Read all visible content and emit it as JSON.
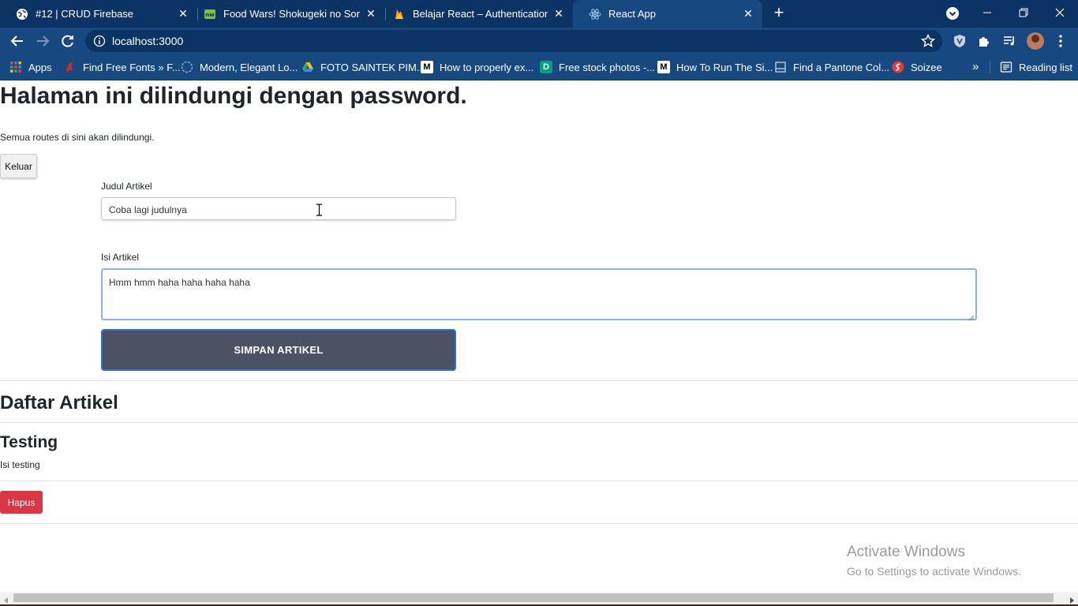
{
  "browser": {
    "tabs": [
      {
        "title": "#12 | CRUD Firebase",
        "favicon": "globe-icon",
        "active": false
      },
      {
        "title": "Food Wars! Shokugeki no Soma t",
        "favicon": "anime-site-icon",
        "active": false
      },
      {
        "title": "Belajar React – Authentication – I",
        "favicon": "firebase-icon",
        "active": false
      },
      {
        "title": "React App",
        "favicon": "react-icon",
        "active": true
      }
    ],
    "new_tab_label": "+",
    "url": "localhost:3000",
    "bookmarks": [
      {
        "label": "Apps",
        "icon": "apps-grid-icon"
      },
      {
        "label": "Find Free Fonts » F...",
        "icon": "fonts-icon"
      },
      {
        "label": "Modern, Elegant Lo...",
        "icon": "logo-icon"
      },
      {
        "label": "FOTO SAINTEK PIM...",
        "icon": "google-drive-icon"
      },
      {
        "label": "How to properly ex...",
        "icon": "medium-icon"
      },
      {
        "label": "Free stock photos -...",
        "icon": "stock-photos-icon"
      },
      {
        "label": "How To Run The Si...",
        "icon": "medium-icon"
      },
      {
        "label": "Find a Pantone Col...",
        "icon": "pantone-icon"
      },
      {
        "label": "Soizee",
        "icon": "soizee-icon"
      }
    ],
    "bookmarks_more": "»",
    "reading_list": "Reading list"
  },
  "page": {
    "title": "Halaman ini dilindungi dengan password.",
    "subtitle": "Semua routes di sini akan dilindungi.",
    "logout_label": "Keluar",
    "form": {
      "title_label": "Judul Artikel",
      "title_value": "Coba lagi judulnya",
      "body_label": "Isi Artikel",
      "body_value": "Hmm hmm haha haha haha haha",
      "submit_label": "SIMPAN ARTIKEL"
    },
    "list_heading": "Daftar Artikel",
    "articles": [
      {
        "title": "Testing",
        "body": "Isi testing",
        "delete_label": "Hapus"
      }
    ]
  },
  "watermark": {
    "line1": "Activate Windows",
    "line2": "Go to Settings to activate Windows."
  },
  "colors": {
    "tabstrip": "#0b3364",
    "toolbar": "#17487f",
    "save_button": "#4b5263",
    "delete_button": "#dc3545"
  }
}
